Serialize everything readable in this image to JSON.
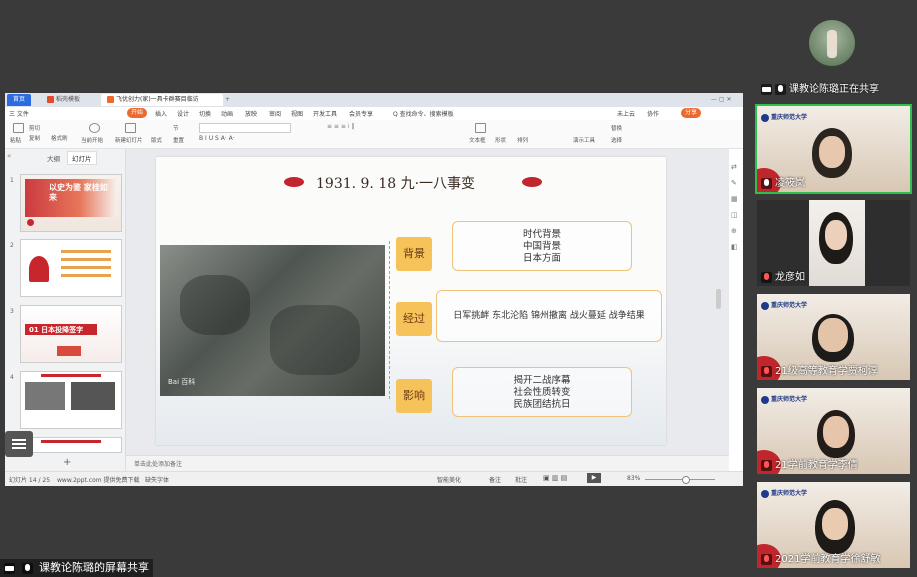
{
  "screen": {
    "tabs": [
      "首页",
      "稻壳模板",
      "飞优创力(家)一具卡群赛目临访"
    ],
    "menu": [
      "三 文件",
      "开始",
      "插入",
      "设计",
      "切换",
      "动画",
      "放映",
      "审阅",
      "视图",
      "开发工具",
      "会员专享",
      "Q 查找命令、搜索模板"
    ],
    "menu_right": [
      "未上云",
      "协作",
      "分享"
    ],
    "toolbar_labels": [
      "粘贴",
      "剪切",
      "复制",
      "格式刷",
      "当前开始",
      "新建幻灯片",
      "版式",
      "节",
      "重置",
      "文本框",
      "形状",
      "排列",
      "演示工具",
      "替换",
      "选择"
    ],
    "left_pane": {
      "tabs": [
        "大纲",
        "幻灯片"
      ],
      "slides": [
        "1",
        "2",
        "3",
        "4",
        "5"
      ],
      "slide1_text": "以史为鉴 家桂如来",
      "slide3_text": "01 日本投降签字"
    },
    "slide": {
      "title": "1931. 9. 18  九·一八事变",
      "photo_caption": "Bai 百科",
      "sections": [
        {
          "label": "背景",
          "lines": [
            "时代背景",
            "中国背景",
            "日本方面"
          ]
        },
        {
          "label": "经过",
          "lines": [
            "日军挑衅  东北沦陷  锦州撤离  战火蔓延  战争结果"
          ]
        },
        {
          "label": "影响",
          "lines": [
            "揭开二战序幕",
            "社会性质转变",
            "民族团结抗日"
          ]
        }
      ]
    },
    "notes": "单击此处添加备注",
    "status": {
      "slide_index": "幻灯片 14 / 25",
      "site": "www.2ppt.com 提供免费下载",
      "font": "缺失字体",
      "beautify": "智能美化",
      "comment": "备注",
      "annotate": "批注",
      "zoom": "83%"
    }
  },
  "share_bar": "课教论陈璐的屏幕共享",
  "participants": [
    {
      "name": "课教论陈璐正在共享"
    },
    {
      "name": "凌筱岚"
    },
    {
      "name": "龙彦如"
    },
    {
      "name": "21级高等教育学贾柯淳"
    },
    {
      "name": "21学前教育学李倩"
    },
    {
      "name": "2021学前教育学徐舒敏"
    }
  ],
  "colors": {
    "accent": "#ec6a2e",
    "pill": "#f6c35a",
    "title_red": "#c0262c"
  }
}
